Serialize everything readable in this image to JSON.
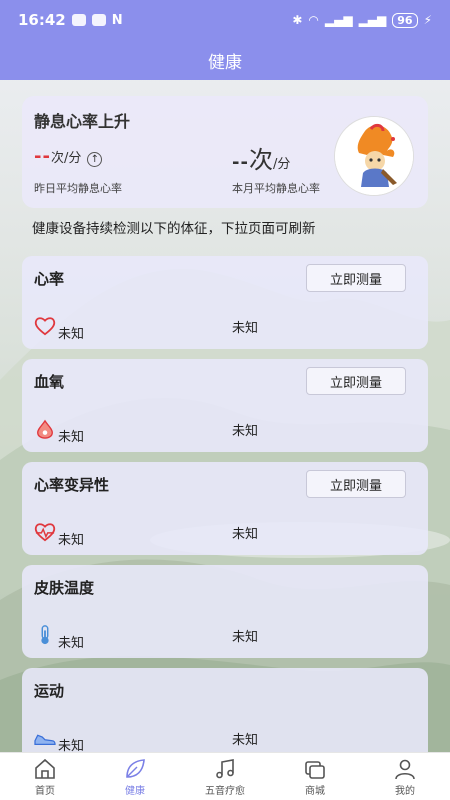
{
  "status_bar": {
    "time": "16:42",
    "battery": "96"
  },
  "header": {
    "title": "健康"
  },
  "summary": {
    "title": "静息心率上升",
    "yesterday_value": "--",
    "yesterday_unit": "次/分",
    "yesterday_label": "昨日平均静息心率",
    "month_value": "--",
    "month_big_unit": "次",
    "month_unit": "/分",
    "month_label": "本月平均静息心率"
  },
  "info_text": "健康设备持续检测以下的体征，下拉页面可刷新",
  "cards": [
    {
      "title": "心率",
      "button": "立即测量",
      "status_left": "未知",
      "status_right": "未知",
      "icon": "heart-icon"
    },
    {
      "title": "血氧",
      "button": "立即测量",
      "status_left": "未知",
      "status_right": "未知",
      "icon": "blood-drop-icon"
    },
    {
      "title": "心率变异性",
      "button": "立即测量",
      "status_left": "未知",
      "status_right": "未知",
      "icon": "heart-pulse-icon"
    },
    {
      "title": "皮肤温度",
      "status_left": "未知",
      "status_right": "未知",
      "icon": "thermometer-icon"
    },
    {
      "title": "运动",
      "status_left": "未知",
      "status_right": "未知",
      "icon": "shoe-icon"
    }
  ],
  "tabs": [
    {
      "label": "首页",
      "icon": "home-icon"
    },
    {
      "label": "健康",
      "icon": "leaf-icon",
      "active": true
    },
    {
      "label": "五音疗愈",
      "icon": "music-note-icon"
    },
    {
      "label": "商城",
      "icon": "shop-icon"
    },
    {
      "label": "我的",
      "icon": "user-icon"
    }
  ],
  "colors": {
    "header": "#8b8fec",
    "accent": "#7b80e6",
    "alert": "#e0383e"
  }
}
